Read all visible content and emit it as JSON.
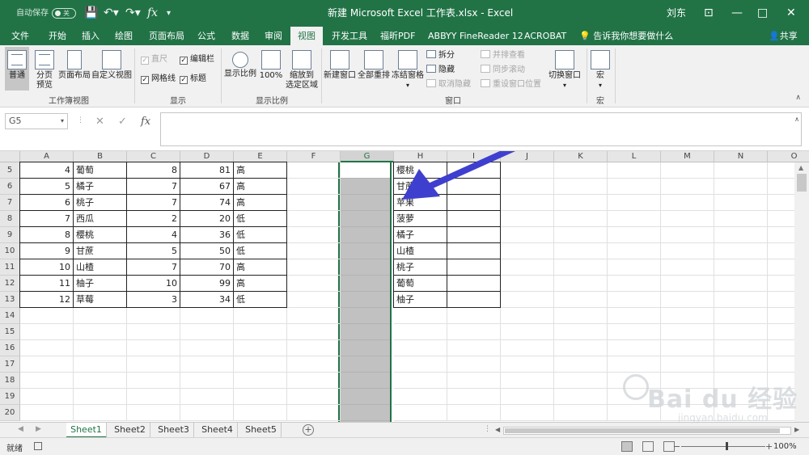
{
  "titlebar": {
    "autosave_label": "自动保存",
    "autosave_state": "关",
    "window_title": "新建 Microsoft Excel 工作表.xlsx  -  Excel",
    "user": "刘东",
    "minimize": "—",
    "maximize": "□",
    "close": "✕",
    "ribbon_options": "⊡"
  },
  "menu": {
    "tabs": [
      "文件",
      "开始",
      "插入",
      "绘图",
      "页面布局",
      "公式",
      "数据",
      "审阅",
      "视图",
      "开发工具",
      "福昕PDF",
      "ABBYY FineReader 12",
      "ACROBAT"
    ],
    "active_tab": "视图",
    "tell_me": "告诉我你想要做什么",
    "share": "共享"
  },
  "ribbon": {
    "workbook_views": {
      "label": "工作簿视图",
      "normal": "普通",
      "page_break_l1": "分页",
      "page_break_l2": "预览",
      "page_layout": "页面布局",
      "custom_views": "自定义视图"
    },
    "show": {
      "label": "显示",
      "ruler": "直尺",
      "formula_bar": "编辑栏",
      "gridlines": "网格线",
      "headings": "标题"
    },
    "zoom": {
      "label": "显示比例",
      "zoom": "显示比例",
      "zoom_100": "100%",
      "zoom_sel_l1": "缩放到",
      "zoom_sel_l2": "选定区域"
    },
    "window": {
      "label": "窗口",
      "new_window": "新建窗口",
      "arrange_all": "全部重排",
      "freeze_panes": "冻结窗格",
      "split": "拆分",
      "hide": "隐藏",
      "unhide": "取消隐藏",
      "side_by_side": "并排查看",
      "sync_scroll": "同步滚动",
      "reset_position": "重设窗口位置",
      "switch_windows": "切换窗口"
    },
    "macros": {
      "label": "宏",
      "macros": "宏"
    }
  },
  "formula_bar": {
    "name_box": "G5",
    "cancel": "✕",
    "enter": "✓",
    "fx": "fx",
    "value": ""
  },
  "grid": {
    "columns": [
      "A",
      "B",
      "C",
      "D",
      "E",
      "F",
      "G",
      "H",
      "I",
      "J",
      "K",
      "L",
      "M",
      "N",
      "O"
    ],
    "selected_column": "G",
    "rows": [
      "5",
      "6",
      "7",
      "8",
      "9",
      "10",
      "11",
      "12",
      "13",
      "14",
      "15",
      "16",
      "17",
      "18",
      "19",
      "20"
    ],
    "table_left": [
      [
        "4",
        "葡萄",
        "8",
        "81",
        "高"
      ],
      [
        "5",
        "橘子",
        "7",
        "67",
        "高"
      ],
      [
        "6",
        "桃子",
        "7",
        "74",
        "高"
      ],
      [
        "7",
        "西瓜",
        "2",
        "20",
        "低"
      ],
      [
        "8",
        "樱桃",
        "4",
        "36",
        "低"
      ],
      [
        "9",
        "甘蔗",
        "5",
        "50",
        "低"
      ],
      [
        "10",
        "山楂",
        "7",
        "70",
        "高"
      ],
      [
        "11",
        "柚子",
        "10",
        "99",
        "高"
      ],
      [
        "12",
        "草莓",
        "3",
        "34",
        "低"
      ]
    ],
    "table_right": [
      "樱桃",
      "甘蔗",
      "苹果",
      "菠萝",
      "橘子",
      "山楂",
      "桃子",
      "葡萄",
      "柚子"
    ]
  },
  "sheet_tabs": {
    "tabs": [
      "Sheet1",
      "Sheet2",
      "Sheet3",
      "Sheet4",
      "Sheet5"
    ],
    "active": "Sheet1",
    "add": "+"
  },
  "status": {
    "ready": "就绪",
    "zoom_minus": "−",
    "zoom_plus": "+",
    "zoom": "100%"
  },
  "watermark": {
    "brand": "Bai  du 经验",
    "url": "jingyan.baidu.com"
  },
  "colors": {
    "excel_green": "#217346",
    "arrow": "#3f3fcf",
    "selected_column": "#c1c1c1"
  }
}
